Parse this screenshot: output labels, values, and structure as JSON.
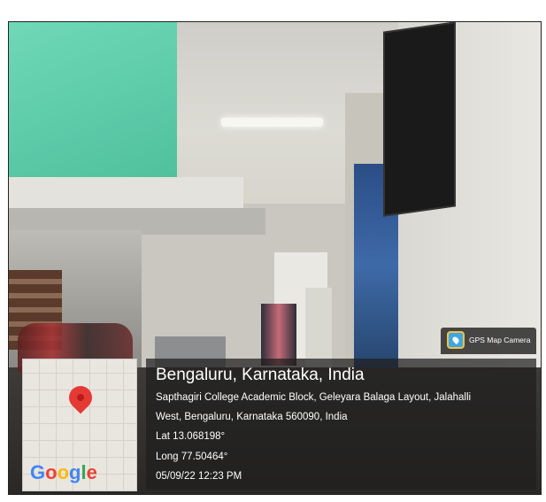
{
  "overlay": {
    "location_title": "Bengaluru, Karnataka, India",
    "address_line1": "Sapthagiri College Academic Block, Geleyara Balaga Layout, Jalahalli",
    "address_line2": "West, Bengaluru, Karnataka 560090, India",
    "lat": "Lat 13.068198°",
    "long": "Long 77.50464°",
    "datetime": "05/09/22 12:23 PM"
  },
  "map": {
    "logo_text": [
      "G",
      "o",
      "o",
      "g",
      "l",
      "e"
    ],
    "logo_colors": [
      "#4285F4",
      "#EA4335",
      "#FBBC05",
      "#4285F4",
      "#34A853",
      "#EA4335"
    ],
    "pin_icon": "map-pin-icon"
  },
  "badge": {
    "label": "GPS Map Camera",
    "icon": "gps-map-camera-icon"
  }
}
